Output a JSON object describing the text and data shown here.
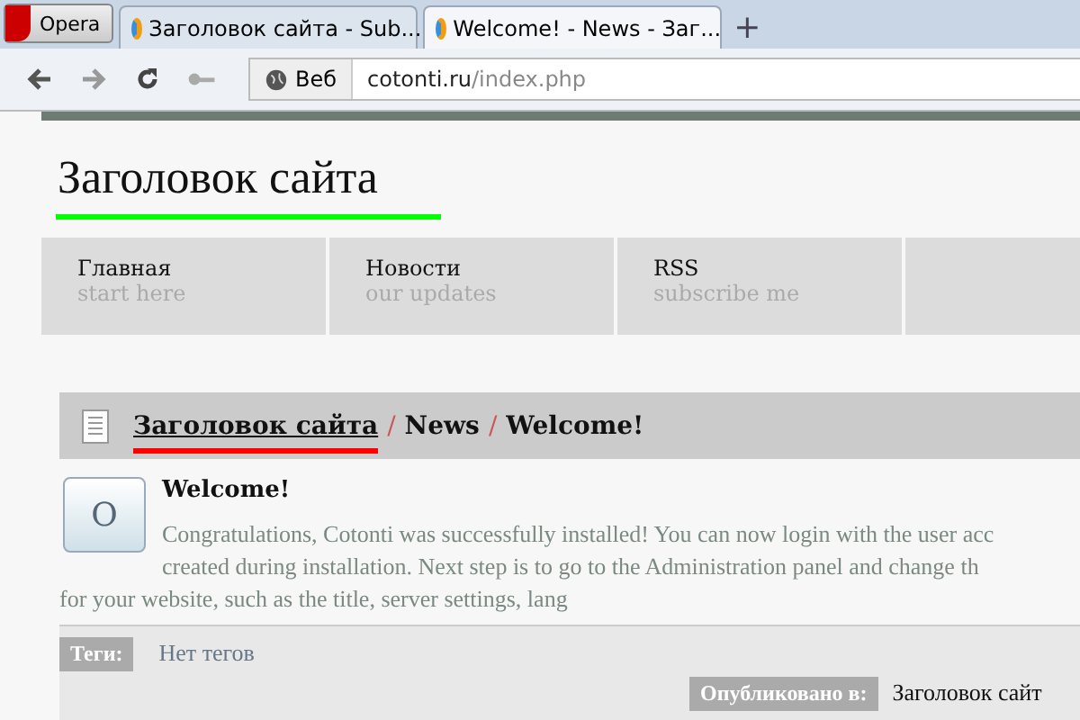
{
  "browser": {
    "menu_button": "Opera",
    "tabs": [
      {
        "title": "Заголовок сайта - Sub...",
        "selected": false
      },
      {
        "title": "Welcome! - News - Заг...",
        "selected": true
      }
    ],
    "new_tab": "+",
    "address": {
      "badge": "Веб",
      "host": "cotonti.ru",
      "path": "/index.php"
    }
  },
  "site": {
    "title": "Заголовок сайта",
    "nav": [
      {
        "label": "Главная",
        "hint": "start here"
      },
      {
        "label": "Новости",
        "hint": "our updates"
      },
      {
        "label": "RSS",
        "hint": "subscribe me"
      }
    ],
    "breadcrumb": [
      {
        "text": "Заголовок сайта",
        "kind": "link"
      },
      {
        "text": "/",
        "kind": "sep"
      },
      {
        "text": "News",
        "kind": "crumb"
      },
      {
        "text": "/",
        "kind": "sep"
      },
      {
        "text": "Welcome!",
        "kind": "crumb"
      }
    ],
    "post": {
      "avatar_letter": "O",
      "title": "Welcome!",
      "lines": [
        "Congratulations, Cotonti was successfully installed! You can now login with the user acc",
        "created during installation. Next step is to go to the Administration panel and change th",
        "for your website, such as the title, server settings, lang"
      ],
      "tags_label": "Теги:",
      "tags_value": "Нет тегов",
      "published_label": "Опубликовано в:",
      "published_value": "Заголовок сайт"
    }
  }
}
